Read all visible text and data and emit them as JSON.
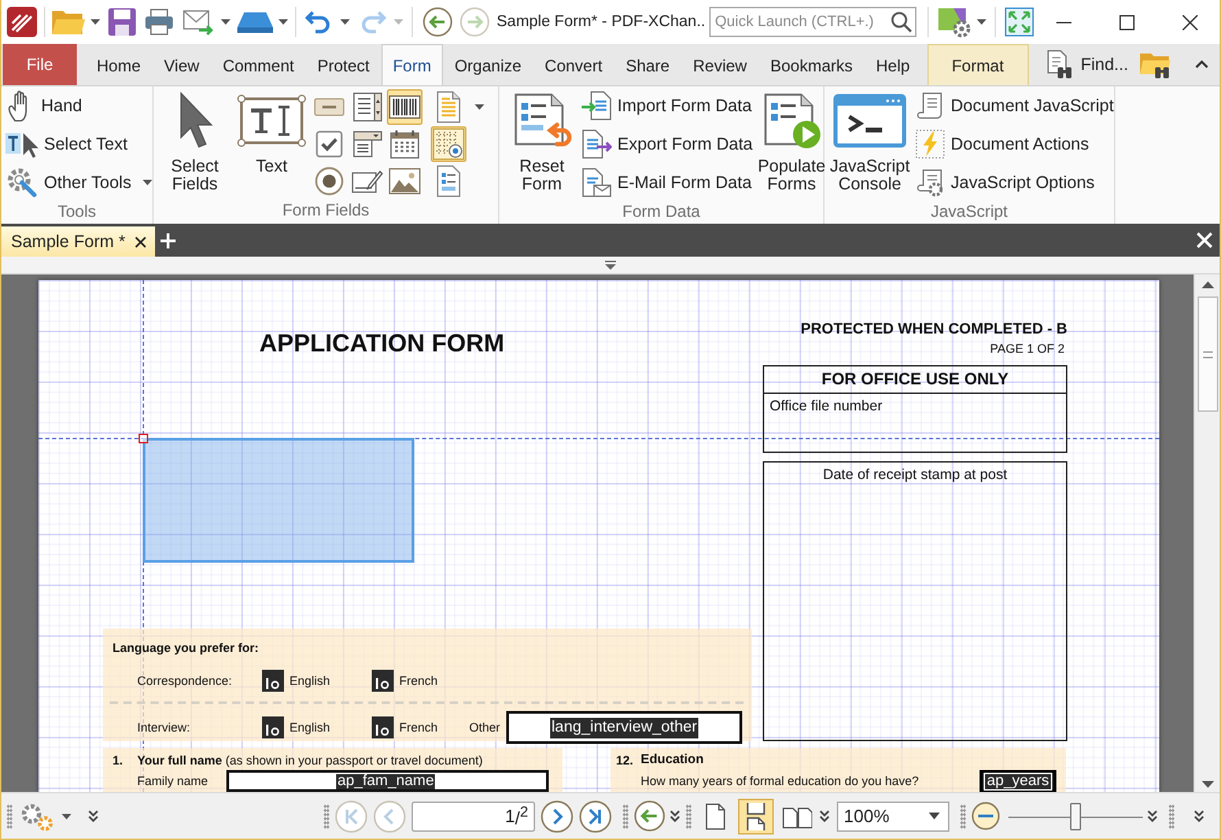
{
  "title_bar": {
    "title": "Sample Form* - PDF-XChan..",
    "history": [
      {
        "disabled": false
      },
      {
        "disabled": true
      }
    ],
    "navigation": [
      {
        "disabled": false
      },
      {
        "disabled": true
      }
    ],
    "quick_launch": {
      "placeholder": "Quick Launch (CTRL+.)"
    }
  },
  "ribbon_tabs": [
    {
      "label": "File",
      "kind": "file",
      "selected": false
    },
    {
      "label": "Home",
      "kind": "tab",
      "selected": false
    },
    {
      "label": "View",
      "kind": "tab",
      "selected": false
    },
    {
      "label": "Comment",
      "kind": "tab",
      "selected": false
    },
    {
      "label": "Protect",
      "kind": "tab",
      "selected": false
    },
    {
      "label": "Form",
      "kind": "tab",
      "selected": true
    },
    {
      "label": "Organize",
      "kind": "tab",
      "selected": false
    },
    {
      "label": "Convert",
      "kind": "tab",
      "selected": false
    },
    {
      "label": "Share",
      "kind": "tab",
      "selected": false
    },
    {
      "label": "Review",
      "kind": "tab",
      "selected": false
    },
    {
      "label": "Bookmarks",
      "kind": "tab",
      "selected": false
    },
    {
      "label": "Help",
      "kind": "tab",
      "selected": false
    },
    {
      "label": "Format",
      "kind": "contextual",
      "selected": false
    }
  ],
  "find": {
    "label": "Find..."
  },
  "ribbon": {
    "tools": {
      "label": "Tools",
      "items": [
        {
          "label": "Hand"
        },
        {
          "label": "Select Text"
        },
        {
          "label": "Other Tools"
        }
      ]
    },
    "form_fields": {
      "label": "Form Fields",
      "large": [
        {
          "label": "Select Fields"
        },
        {
          "label": "Text"
        }
      ],
      "field_tools": [
        {
          "selected": false
        },
        {
          "selected": false
        },
        {
          "selected": true
        },
        {
          "selected": false
        },
        {
          "selected": false
        },
        {
          "selected": false
        },
        {
          "selected": false
        },
        {
          "selected": false
        },
        {
          "selected": false
        }
      ],
      "view_tools": [
        {
          "on": false
        },
        {
          "on": true
        },
        {
          "on": false
        }
      ]
    },
    "form_data": {
      "label": "Form Data",
      "reset": {
        "label": "Reset Form"
      },
      "items": [
        {
          "label": "Import Form Data"
        },
        {
          "label": "Export Form Data"
        },
        {
          "label": "E-Mail Form Data"
        }
      ],
      "populate": {
        "label": "Populate Forms"
      }
    },
    "javascript": {
      "label": "JavaScript",
      "console": {
        "label": "JavaScript Console"
      },
      "items": [
        {
          "label": "Document JavaScript"
        },
        {
          "label": "Document Actions"
        },
        {
          "label": "JavaScript Options"
        }
      ]
    }
  },
  "document_tabs": [
    {
      "label": "Sample Form *",
      "selected": true
    }
  ],
  "page": {
    "title": "APPLICATION FORM",
    "protection": "PROTECTED WHEN COMPLETED - B",
    "page_label": "PAGE 1 OF 2",
    "office_box": {
      "heading": "FOR OFFICE USE ONLY",
      "label": "Office file number"
    },
    "stamp_box": {
      "label": "Date of receipt stamp at post"
    },
    "language": {
      "heading": "Language you prefer for:",
      "rows": [
        {
          "label": "Correspondence:",
          "options": [
            {
              "label": "English"
            },
            {
              "label": "French"
            }
          ]
        },
        {
          "label": "Interview:",
          "options": [
            {
              "label": "English"
            },
            {
              "label": "French"
            }
          ],
          "other": {
            "label": "Other",
            "field": "lang_interview_other"
          }
        }
      ]
    },
    "full_name": {
      "number": "1.",
      "heading": "**Your full name** (as shown in your passport or travel document)",
      "fields": [
        {
          "label": "Family name",
          "field": "ap_fam_name"
        }
      ]
    },
    "education": {
      "number": "12.",
      "heading": "Education",
      "question": "How many years of formal education do you have?",
      "field": "ap_years"
    }
  },
  "status_bar": {
    "page_nav": [
      {
        "disabled": true
      },
      {
        "disabled": true
      },
      {
        "disabled": false
      },
      {
        "disabled": false
      }
    ],
    "page_number": {
      "value": "1",
      "total": "/$^{2}$"
    },
    "layouts": [
      {
        "selected": false
      },
      {
        "selected": true
      },
      {
        "selected": false
      }
    ],
    "zoom": {
      "value": "100%"
    },
    "zoom_slider": {
      "level": 0.5
    }
  }
}
